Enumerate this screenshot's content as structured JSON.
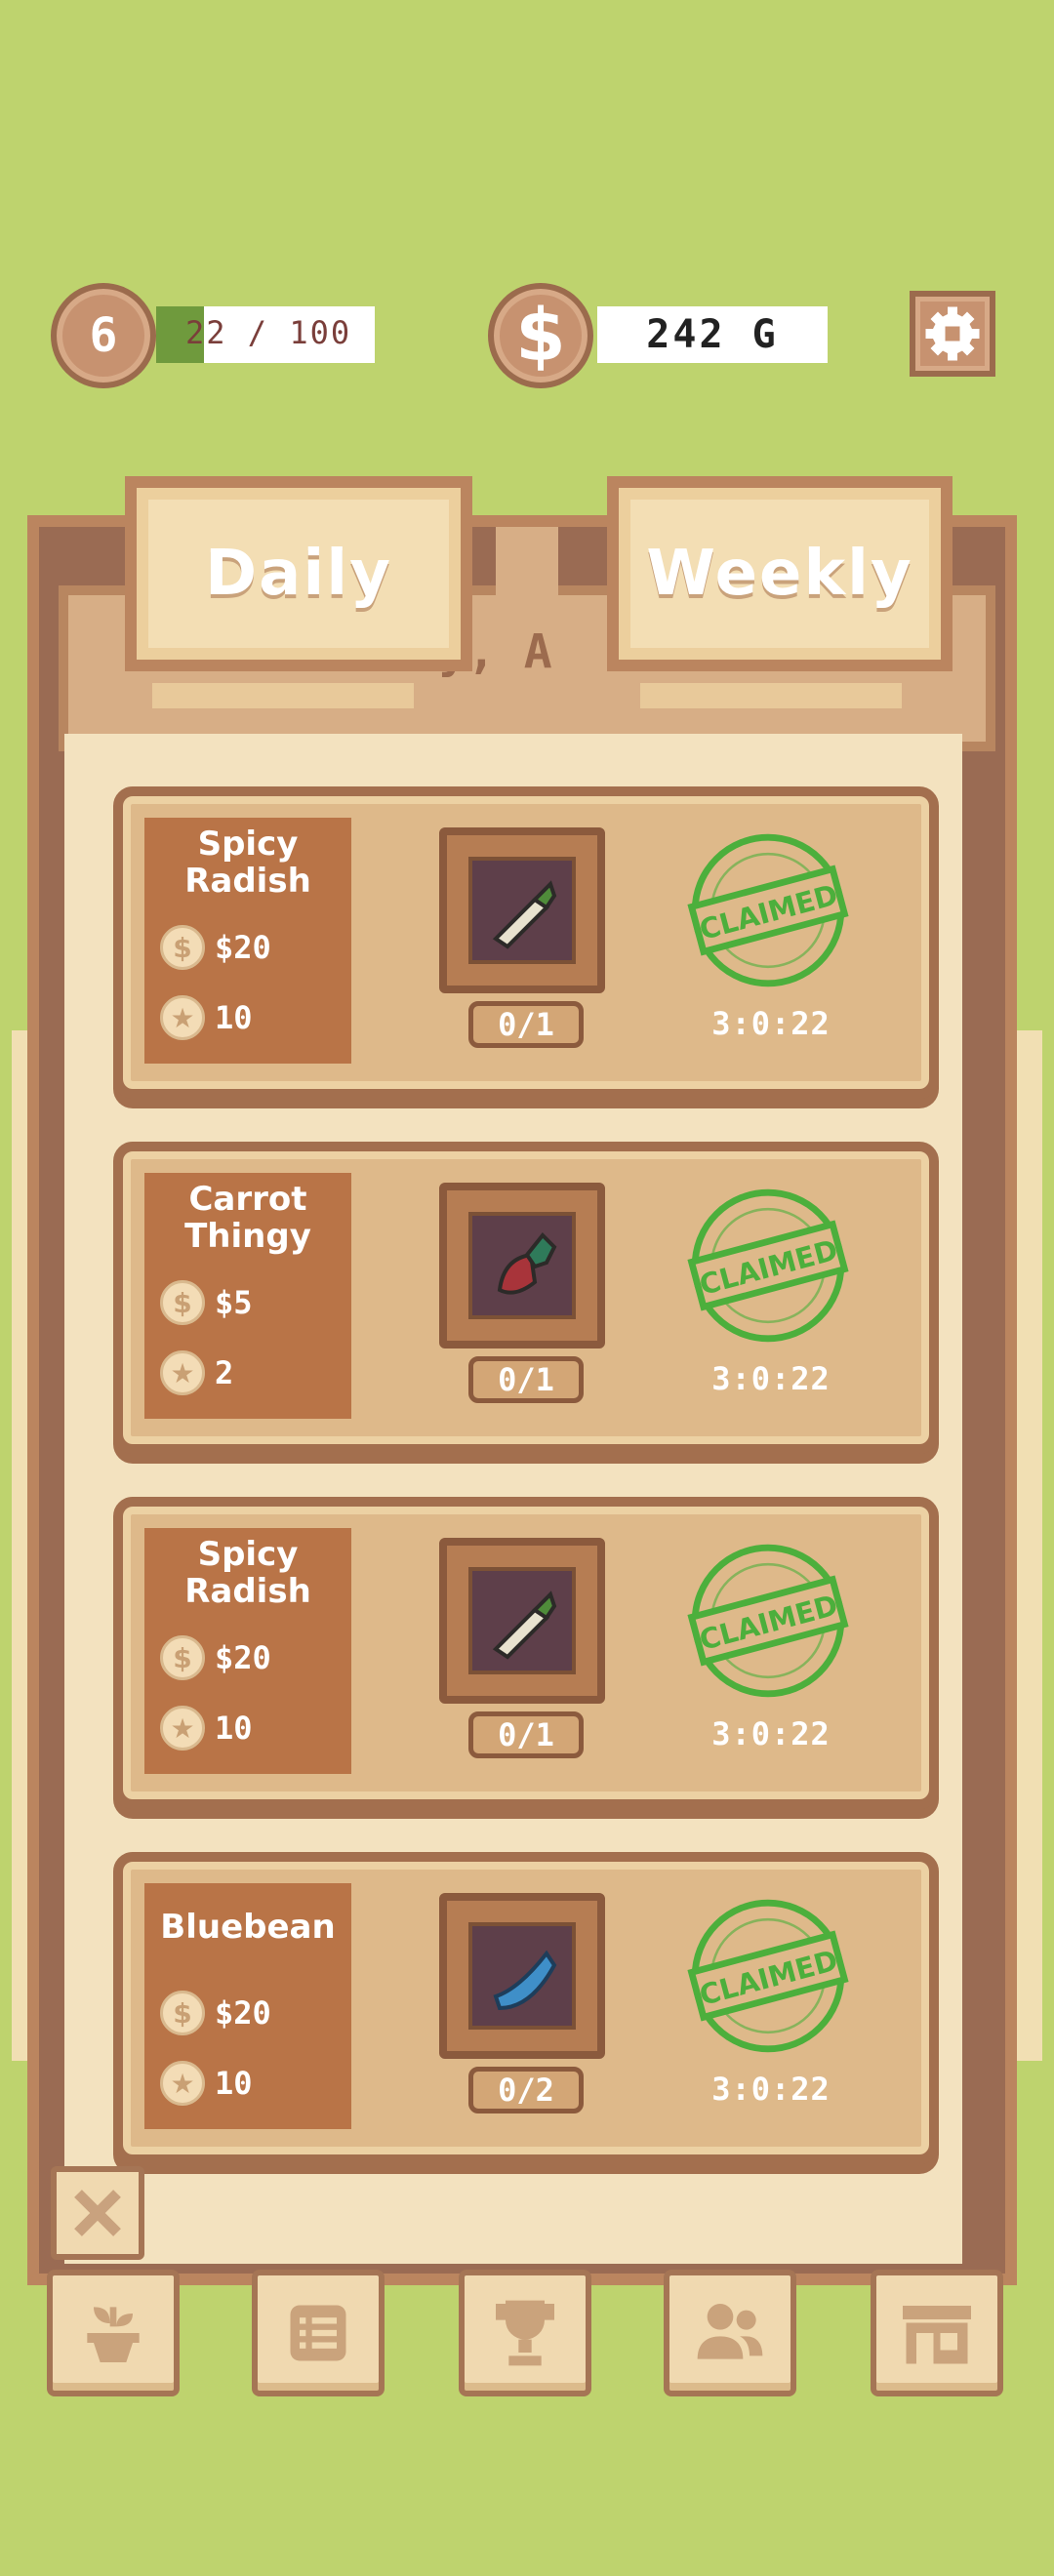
{
  "hud": {
    "level": "6",
    "xp_text": "22 / 100",
    "xp_fraction": 0.22,
    "money": "242 G",
    "currency_symbol": "$"
  },
  "tabs": {
    "daily": "Daily",
    "weekly": "Weekly",
    "partial_label": "y, A"
  },
  "quests": [
    {
      "name_line1": "Spicy",
      "name_line2": "Radish",
      "money": "$20",
      "stars": "10",
      "count": "0/1",
      "status": "CLAIMED",
      "timer": "3:0:22",
      "item_icon": "radish-icon"
    },
    {
      "name_line1": "Carrot",
      "name_line2": "Thingy",
      "money": "$5",
      "stars": "2",
      "count": "0/1",
      "status": "CLAIMED",
      "timer": "3:0:22",
      "item_icon": "carrot-icon"
    },
    {
      "name_line1": "Spicy",
      "name_line2": "Radish",
      "money": "$20",
      "stars": "10",
      "count": "0/1",
      "status": "CLAIMED",
      "timer": "3:0:22",
      "item_icon": "radish-icon"
    },
    {
      "name_line1": "Bluebean",
      "name_line2": "",
      "money": "$20",
      "stars": "10",
      "count": "0/2",
      "status": "CLAIMED",
      "timer": "3:0:22",
      "item_icon": "bluebean-icon"
    }
  ],
  "nav": [
    "plant-icon",
    "list-icon",
    "trophy-icon",
    "friends-icon",
    "shop-icon"
  ],
  "colors": {
    "background": "#bed36e",
    "stamp_green": "#4caf3c",
    "card": "#deb98a",
    "card_label": "#b97447"
  }
}
